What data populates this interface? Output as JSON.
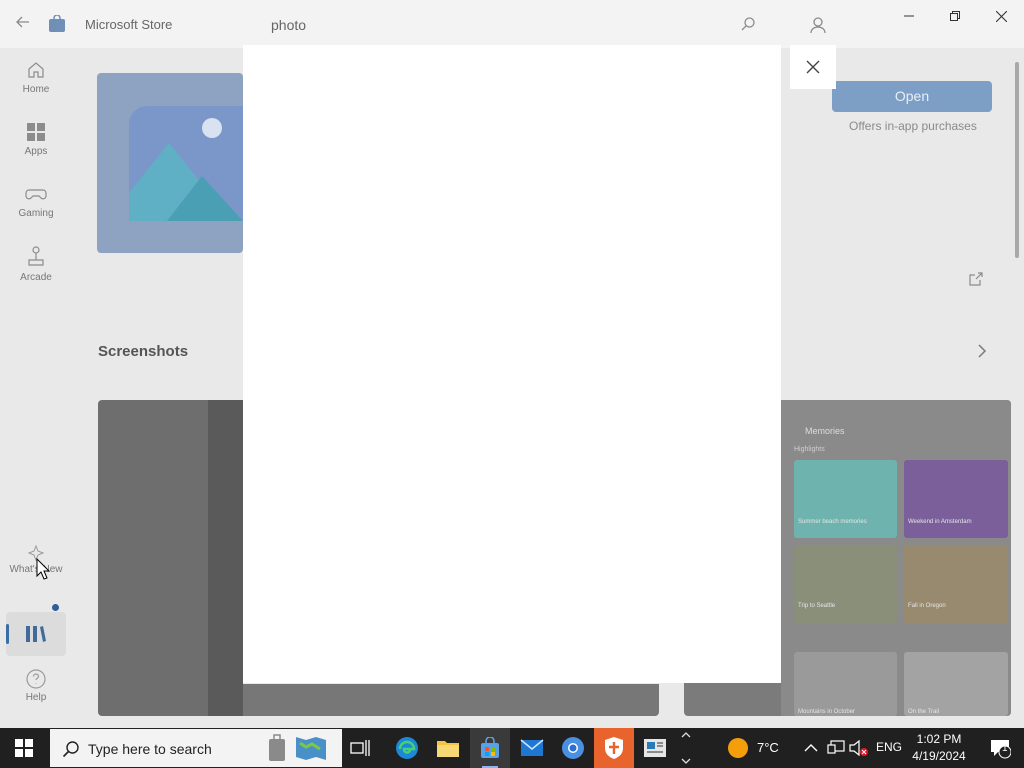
{
  "window": {
    "app_title": "Microsoft Store",
    "search_value": "photo"
  },
  "nav": {
    "items": [
      {
        "label": "Home",
        "icon": "home-icon"
      },
      {
        "label": "Apps",
        "icon": "apps-icon"
      },
      {
        "label": "Gaming",
        "icon": "gaming-icon"
      },
      {
        "label": "Arcade",
        "icon": "arcade-icon"
      }
    ],
    "whats_new": "What's New",
    "help": "Help"
  },
  "product": {
    "open_label": "Open",
    "offers_text": "Offers in-app purchases"
  },
  "screenshots": {
    "title": "Screenshots",
    "right_shot": {
      "title": "Memories",
      "subtitle": "Highlights",
      "captions": [
        "Summer beach memories",
        "Weekend in Amsterdam",
        "Trip to Seattle",
        "Fall in Oregon",
        "Mountains in October",
        "On the Trail"
      ]
    }
  },
  "taskbar": {
    "search_placeholder": "Type here to search",
    "weather_temp": "7°C",
    "language": "ENG",
    "time": "1:02 PM",
    "date": "4/19/2024",
    "notification_count": "1"
  }
}
